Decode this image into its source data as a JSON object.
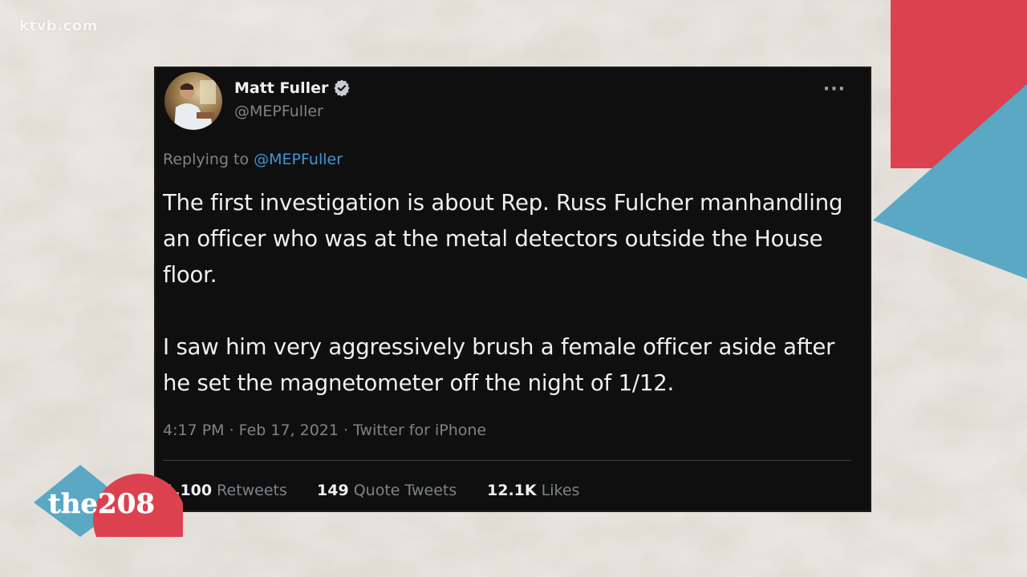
{
  "watermark": "ktvb.com",
  "tweet": {
    "display_name": "Matt Fuller",
    "handle": "@MEPFuller",
    "more_label": "···",
    "reply_prefix": "Replying to ",
    "reply_to": "@MEPFuller",
    "paragraphs": [
      "The first investigation is about Rep. Russ Fulcher manhandling an officer who was at the metal detectors outside the House floor.",
      "I saw him very aggressively brush a female officer aside after he set the magnetometer off the night of 1/12."
    ],
    "meta": "4:17 PM · Feb 17, 2021 · Twitter for iPhone",
    "stats": {
      "retweets_count": "1,100",
      "retweets_label": "Retweets",
      "quotes_count": "149",
      "quotes_label": "Quote Tweets",
      "likes_count": "12.1K",
      "likes_label": "Likes"
    }
  },
  "logo": {
    "text": "the208"
  },
  "colors": {
    "accent_red": "#dc4150",
    "accent_teal": "#5aa8c4",
    "card_bg": "#0f0f0f",
    "link_blue": "#3b97d6",
    "verified_blue": "#c9cccf"
  },
  "icons": {
    "verified": "verified-badge-icon",
    "more": "more-options-icon"
  }
}
